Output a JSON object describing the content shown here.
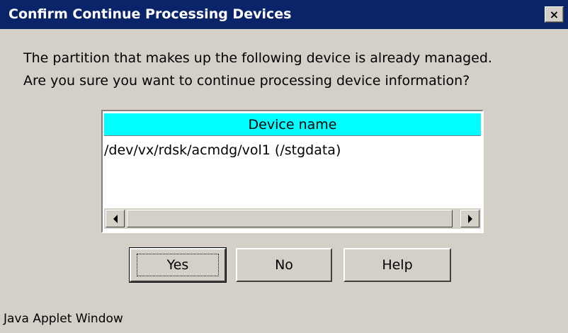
{
  "window": {
    "title": "Confirm Continue Processing Devices",
    "close_label": "×",
    "status_text": "Java Applet Window"
  },
  "message": {
    "line1": "The partition that makes up the following device is already managed.",
    "line2": "Are you sure you want to continue processing device information?"
  },
  "table": {
    "column_header": "Device name",
    "rows": [
      "/dev/vx/rdsk/acmdg/vol1 (/stgdata)"
    ]
  },
  "buttons": {
    "yes": "Yes",
    "no": "No",
    "help": "Help"
  },
  "colors": {
    "titlebar": "#0a246a",
    "header": "#00ffff",
    "dialog_bg": "#d4d0c8"
  }
}
